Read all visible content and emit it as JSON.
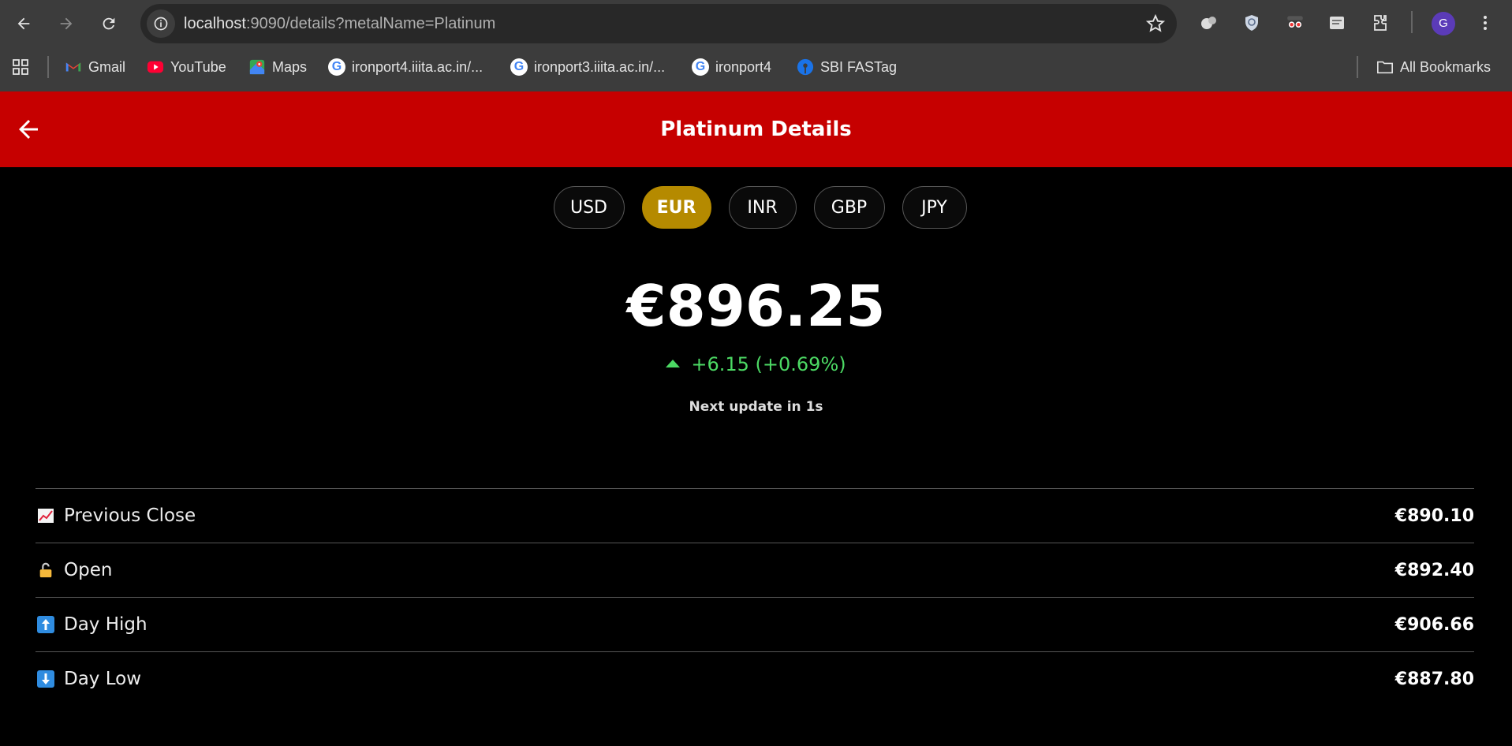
{
  "browser": {
    "url_host": "localhost",
    "url_rest": ":9090/details?metalName=Platinum",
    "profile_initial": "G",
    "bookmarks": [
      {
        "label": "Gmail",
        "icon": "gmail-icon"
      },
      {
        "label": "YouTube",
        "icon": "youtube-icon"
      },
      {
        "label": "Maps",
        "icon": "maps-icon"
      },
      {
        "label": "ironport4.iiita.ac.in/...",
        "icon": "google-icon"
      },
      {
        "label": "ironport3.iiita.ac.in/...",
        "icon": "google-icon"
      },
      {
        "label": "ironport4",
        "icon": "google-icon"
      },
      {
        "label": "SBI FASTag",
        "icon": "sbi-icon"
      }
    ],
    "all_bookmarks": "All Bookmarks"
  },
  "header": {
    "title": "Platinum Details"
  },
  "currencies": {
    "items": [
      "USD",
      "EUR",
      "INR",
      "GBP",
      "JPY"
    ],
    "selected": "EUR"
  },
  "quote": {
    "price": "€896.25",
    "change": "+6.15 (+0.69%)",
    "update": "Next update in 1s"
  },
  "stats": [
    {
      "label": "Previous Close",
      "value": "€890.10",
      "icon": "chart-increasing-icon"
    },
    {
      "label": "Open",
      "value": "€892.40",
      "icon": "unlocked-icon"
    },
    {
      "label": "Day High",
      "value": "€906.66",
      "icon": "up-arrow-icon"
    },
    {
      "label": "Day Low",
      "value": "€887.80",
      "icon": "down-arrow-icon"
    }
  ],
  "colors": {
    "header_bg": "#c60000",
    "active_tab": "#b58a00",
    "positive": "#4cd964"
  }
}
